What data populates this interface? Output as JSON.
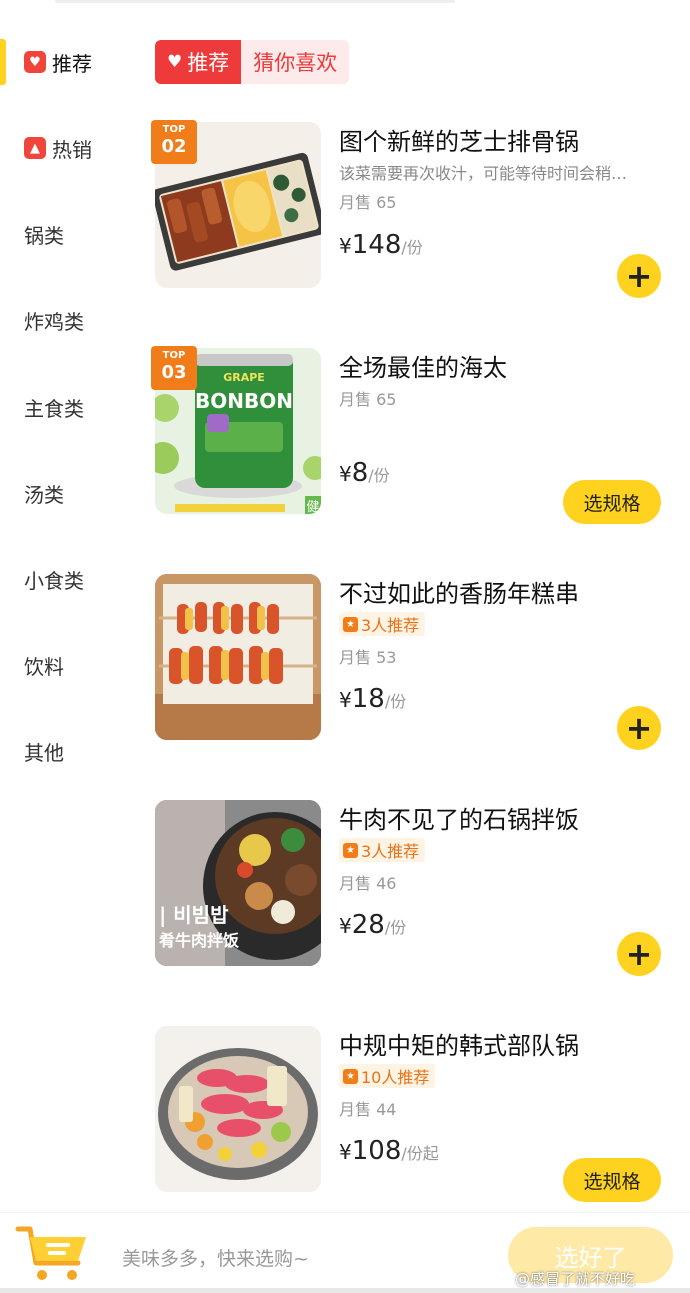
{
  "sidebar": {
    "items": [
      {
        "label": "推荐",
        "icon": "heart-icon",
        "active": true
      },
      {
        "label": "热销",
        "icon": "flame-icon"
      },
      {
        "label": "锅类"
      },
      {
        "label": "炸鸡类"
      },
      {
        "label": "主食类"
      },
      {
        "label": "汤类"
      },
      {
        "label": "小食类"
      },
      {
        "label": "饮料"
      },
      {
        "label": "其他"
      }
    ]
  },
  "section": {
    "chip": "推荐",
    "subtitle": "猜你喜欢"
  },
  "products": [
    {
      "top_badge": {
        "label": "TOP",
        "rank": "02"
      },
      "name": "图个新鲜的芝士排骨锅",
      "desc": "该菜需要再次收汁，可能等待时间会稍…",
      "sales": "月售 65",
      "currency": "¥",
      "price": "148",
      "unit": "/份",
      "action": "+"
    },
    {
      "top_badge": {
        "label": "TOP",
        "rank": "03"
      },
      "name": "全场最佳的海太",
      "sales": "月售 65",
      "currency": "¥",
      "price": "8",
      "unit": "/份",
      "action": "选规格",
      "image_text": {
        "brand": "BONBON",
        "flavor": "GRAPE",
        "corner": "健"
      }
    },
    {
      "name": "不过如此的香肠年糕串",
      "recommend": "3人推荐",
      "sales": "月售 53",
      "currency": "¥",
      "price": "18",
      "unit": "/份",
      "action": "+"
    },
    {
      "name": "牛肉不见了的石锅拌饭",
      "recommend": "3人推荐",
      "sales": "月售 46",
      "currency": "¥",
      "price": "28",
      "unit": "/份",
      "action": "+",
      "image_text": {
        "korean": "| 비빔밥",
        "chinese": "肴牛肉拌饭"
      }
    },
    {
      "name": "中规中矩的韩式部队锅",
      "recommend": "10人推荐",
      "sales": "月售 44",
      "currency": "¥",
      "price": "108",
      "unit": "/份起",
      "action": "选规格"
    }
  ],
  "bottom": {
    "hint": "美味多多，快来选购~",
    "done_label": "选好了",
    "watermark": "@感冒了就不好吃"
  },
  "colors": {
    "accent_yellow": "#ffd21f",
    "red": "#ee3a3a",
    "orange": "#f07d1a"
  }
}
